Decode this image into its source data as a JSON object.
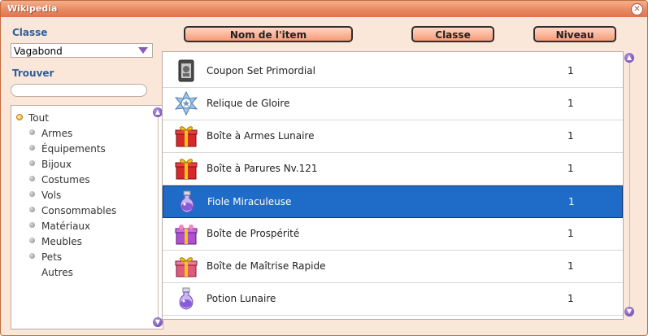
{
  "window": {
    "title": "Wikipedia",
    "close_glyph": "✕"
  },
  "left": {
    "class_label": "Classe",
    "class_value": "Vagabond",
    "find_label": "Trouver",
    "search_value": "",
    "tree": [
      {
        "label": "Tout",
        "bullet": "active"
      },
      {
        "label": "Armes",
        "bullet": "normal"
      },
      {
        "label": "Équipements",
        "bullet": "normal"
      },
      {
        "label": "Bijoux",
        "bullet": "normal"
      },
      {
        "label": "Costumes",
        "bullet": "normal"
      },
      {
        "label": "Vols",
        "bullet": "normal"
      },
      {
        "label": "Consommables",
        "bullet": "normal"
      },
      {
        "label": "Matériaux",
        "bullet": "normal"
      },
      {
        "label": "Meubles",
        "bullet": "normal"
      },
      {
        "label": "Pets",
        "bullet": "normal"
      },
      {
        "label": "Autres",
        "bullet": "none"
      }
    ]
  },
  "headers": {
    "name": "Nom de l'item",
    "class": "Classe",
    "level": "Niveau"
  },
  "items": [
    {
      "name": "Coupon Set Primordial",
      "level": "1",
      "icon": "coupon-icon"
    },
    {
      "name": "Relique de Gloire",
      "level": "1",
      "icon": "relic-icon"
    },
    {
      "name": "Boîte à Armes Lunaire",
      "level": "1",
      "icon": "gift-box-icon"
    },
    {
      "name": "Boîte à Parures Nv.121",
      "level": "1",
      "icon": "gift-box-icon"
    },
    {
      "name": "Fiole Miraculeuse",
      "level": "1",
      "icon": "potion-icon",
      "selected": true
    },
    {
      "name": "Boîte de Prospérité",
      "level": "1",
      "icon": "purple-box-icon"
    },
    {
      "name": "Boîte de Maîtrise Rapide",
      "level": "1",
      "icon": "pink-box-icon"
    },
    {
      "name": "Potion Lunaire",
      "level": "1",
      "icon": "potion-icon"
    }
  ]
}
